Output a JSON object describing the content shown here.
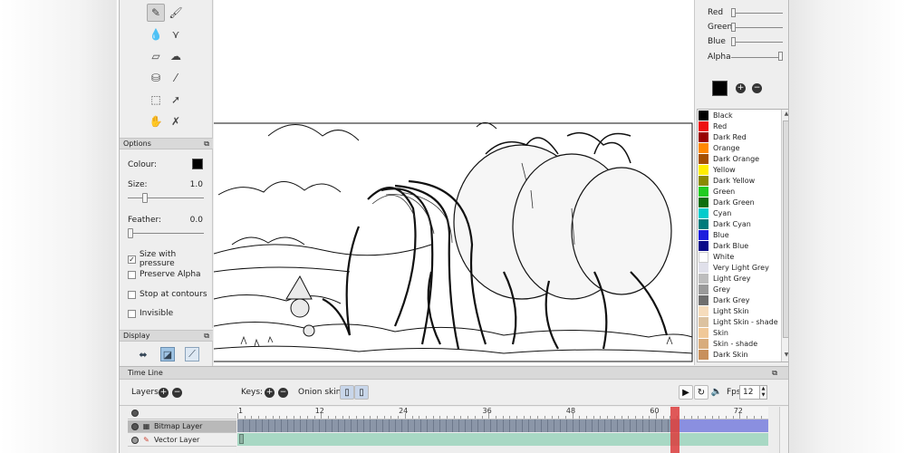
{
  "options": {
    "title": "Options",
    "colour_label": "Colour:",
    "size_label": "Size:",
    "size_value": "1.0",
    "feather_label": "Feather:",
    "feather_value": "0.0",
    "size_with_pressure": "Size with pressure",
    "preserve_alpha": "Preserve Alpha",
    "stop_at_contours": "Stop at contours",
    "invisible": "Invisible"
  },
  "display": {
    "title": "Display"
  },
  "color_panel": {
    "red_label": "Red",
    "green_label": "Green",
    "blue_label": "Blue",
    "alpha_label": "Alpha",
    "add_symbol": "+",
    "remove_symbol": "−",
    "colors": [
      {
        "name": "Black",
        "hex": "#000000"
      },
      {
        "name": "Red",
        "hex": "#ee1111"
      },
      {
        "name": "Dark Red",
        "hex": "#990000"
      },
      {
        "name": "Orange",
        "hex": "#ff8800"
      },
      {
        "name": "Dark Orange",
        "hex": "#a65000"
      },
      {
        "name": "Yellow",
        "hex": "#ffee00"
      },
      {
        "name": "Dark Yellow",
        "hex": "#8a8a00"
      },
      {
        "name": "Green",
        "hex": "#22cc22"
      },
      {
        "name": "Dark Green",
        "hex": "#0e6e0e"
      },
      {
        "name": "Cyan",
        "hex": "#00cccc"
      },
      {
        "name": "Dark Cyan",
        "hex": "#007b7b"
      },
      {
        "name": "Blue",
        "hex": "#1d1ddd"
      },
      {
        "name": "Dark Blue",
        "hex": "#0a0a88"
      },
      {
        "name": "White",
        "hex": "#ffffff"
      },
      {
        "name": "Very Light Grey",
        "hex": "#e0e0ea"
      },
      {
        "name": "Light Grey",
        "hex": "#bdbdbd"
      },
      {
        "name": "Grey",
        "hex": "#9a9a9a"
      },
      {
        "name": "Dark Grey",
        "hex": "#6e6e6e"
      },
      {
        "name": "Light Skin",
        "hex": "#f6dcbc"
      },
      {
        "name": "Light Skin - shade",
        "hex": "#dcc2a0"
      },
      {
        "name": "Skin",
        "hex": "#f0c898"
      },
      {
        "name": "Skin - shade",
        "hex": "#d8ac7c"
      },
      {
        "name": "Dark Skin",
        "hex": "#c8905c"
      }
    ]
  },
  "timeline": {
    "title": "Time Line",
    "layers_label": "Layers:",
    "keys_label": "Keys:",
    "onion_label": "Onion skin:",
    "fps_label": "Fps:",
    "fps_value": "12",
    "play_symbol": "▶",
    "loop_symbol": "↻",
    "sound_symbol": "🔈",
    "ruler_labels": [
      "1",
      "12",
      "24",
      "36",
      "48",
      "60",
      "72"
    ],
    "layers": [
      {
        "name": "Bitmap Layer",
        "selected": true
      },
      {
        "name": "Vector Layer",
        "selected": false
      }
    ]
  }
}
